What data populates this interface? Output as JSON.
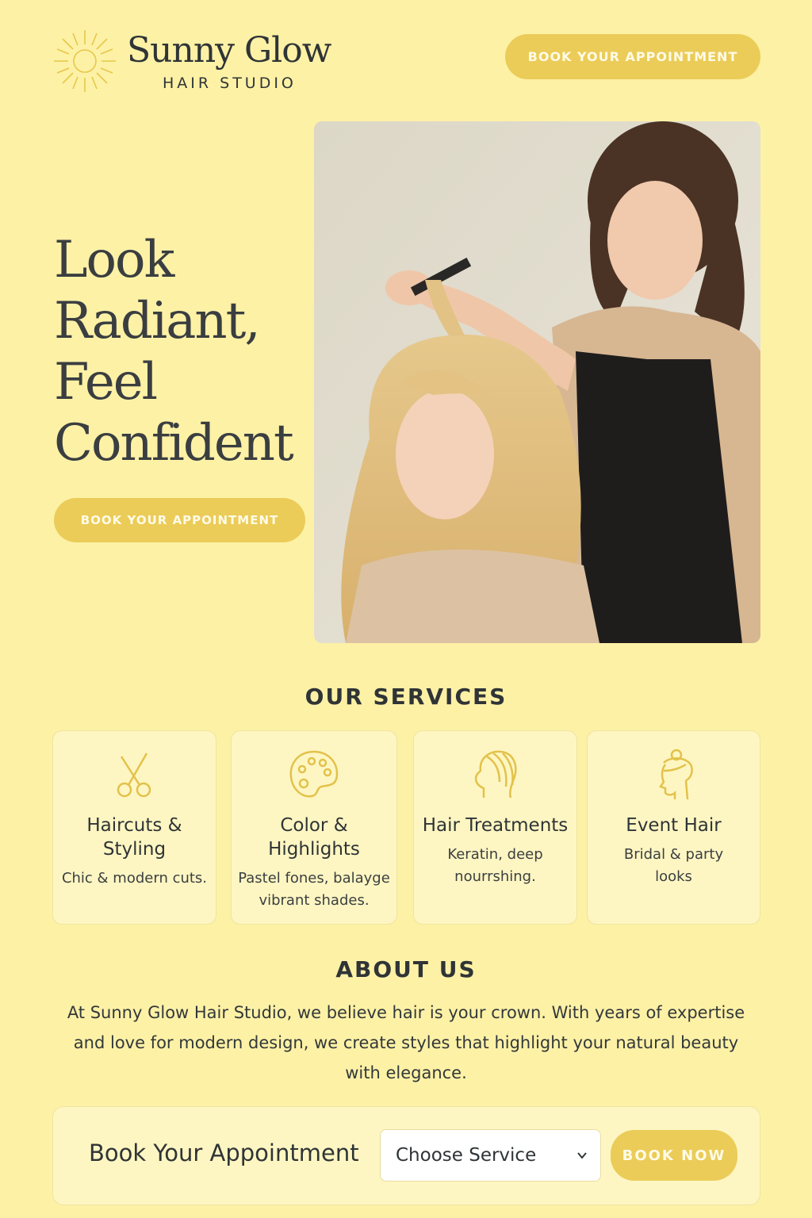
{
  "header": {
    "brand_name": "Sunny Glow",
    "brand_sub": "HAIR STUDIO",
    "cta_label": "BOOK YOUR APPOINTMENT"
  },
  "hero": {
    "title_lines": [
      "Look",
      "Radiant,",
      "Feel",
      "Confident"
    ],
    "cta_label": "BOOK YOUR APPOINTMENT"
  },
  "services": {
    "title": "OUR SERVICES",
    "items": [
      {
        "icon": "scissors-icon",
        "title": "Haircuts & Styling",
        "desc": "Chic & modern cuts."
      },
      {
        "icon": "palette-icon",
        "title": "Color & Highlights",
        "desc": "Pastel fones, balayge vibrant shades."
      },
      {
        "icon": "hair-head-icon",
        "title": "Hair Treatments",
        "desc": "Keratin, deep nourrshing."
      },
      {
        "icon": "updo-head-icon",
        "title": "Event Hair",
        "desc": "Bridal & party looks"
      }
    ]
  },
  "about": {
    "title": "ABOUT US",
    "text": "At Sunny Glow Hair Studio, we believe hair is your crown. With years of expertise and love for modern design, we create styles that highlight your natural beauty with elegance."
  },
  "booking": {
    "label": "Book Your Appointment",
    "select_value": "Choose Service",
    "button_label": "BOOK NOW"
  },
  "colors": {
    "background": "#fdf1a6",
    "accent": "#ebcc58",
    "card": "#fef6c2",
    "text": "#2f3436"
  }
}
